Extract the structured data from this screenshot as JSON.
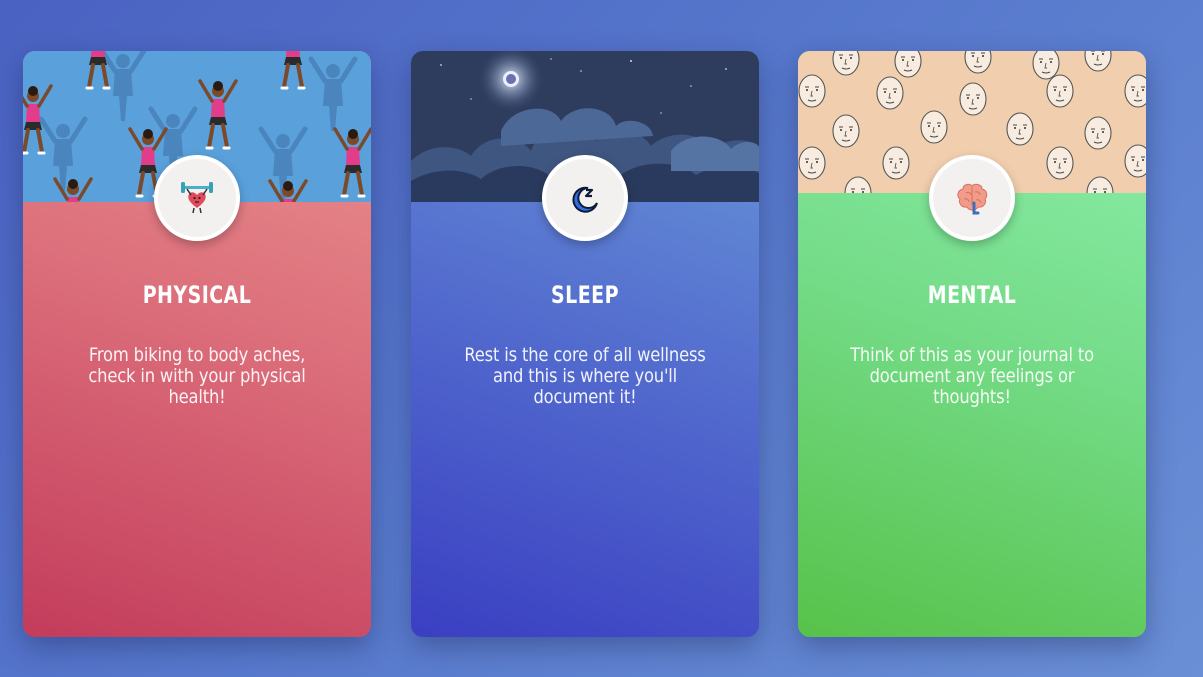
{
  "cards": [
    {
      "key": "physical",
      "title": "PHYSICAL",
      "description": "From biking to body aches, check in with your physical health!",
      "icon": "weightlifting-heart-icon",
      "banner": "dancers-pattern-image",
      "color": "#dc6f7b"
    },
    {
      "key": "sleep",
      "title": "SLEEP",
      "description": "Rest is the core of all wellness and this is where you'll document it!",
      "icon": "crescent-moon-zzz-icon",
      "banner": "night-sky-clouds-image",
      "color": "#5570cf"
    },
    {
      "key": "mental",
      "title": "MENTAL",
      "description": "Think of this as your journal to document any feelings or thoughts!",
      "icon": "brain-icon",
      "banner": "faces-pattern-image",
      "color": "#76dd8b"
    }
  ]
}
